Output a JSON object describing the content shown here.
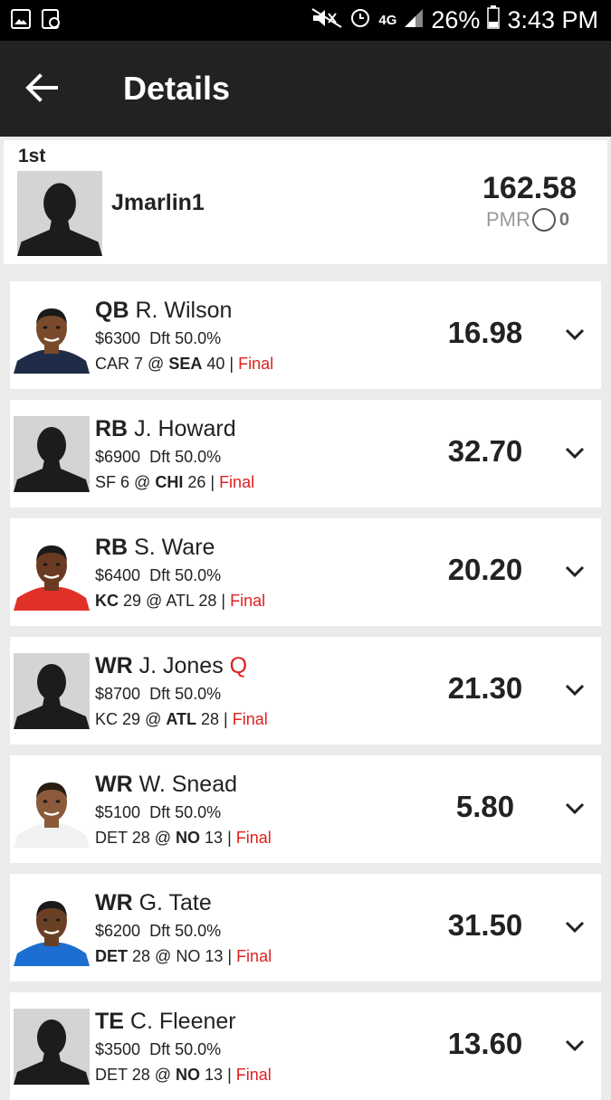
{
  "status_bar": {
    "battery": "26%",
    "time": "3:43 PM",
    "network": "4G",
    "icons": [
      "image-icon",
      "sync-icon",
      "mute-icon",
      "alarm-icon",
      "signal-icon",
      "battery-icon"
    ]
  },
  "app_bar": {
    "title": "Details",
    "back_icon": "arrow-left-icon"
  },
  "summary": {
    "rank": "1st",
    "username": "Jmarlin1",
    "total": "162.58",
    "pmr_label": "PMR",
    "pmr_value": "0"
  },
  "players": [
    {
      "pos": "QB",
      "name": "R. Wilson",
      "injury": "",
      "salary": "$6300",
      "drafted": "Dft 50.0%",
      "away": "CAR",
      "away_score": "7",
      "home": "SEA",
      "home_score": "40",
      "bold": "home",
      "status": "Final",
      "points": "16.98",
      "photo": "headshot",
      "skin": "#7a4a2c",
      "jersey": "#1e2c48",
      "hair": "#1a1a1a"
    },
    {
      "pos": "RB",
      "name": "J. Howard",
      "injury": "",
      "salary": "$6900",
      "drafted": "Dft 50.0%",
      "away": "SF",
      "away_score": "6",
      "home": "CHI",
      "home_score": "26",
      "bold": "home",
      "status": "Final",
      "points": "32.70",
      "photo": "silhouette"
    },
    {
      "pos": "RB",
      "name": "S. Ware",
      "injury": "",
      "salary": "$6400",
      "drafted": "Dft 50.0%",
      "away": "KC",
      "away_score": "29",
      "home": "ATL",
      "home_score": "28",
      "bold": "away",
      "status": "Final",
      "points": "20.20",
      "photo": "headshot",
      "skin": "#6a3a22",
      "jersey": "#e03028",
      "hair": "#1a1a1a"
    },
    {
      "pos": "WR",
      "name": "J. Jones",
      "injury": "Q",
      "salary": "$8700",
      "drafted": "Dft 50.0%",
      "away": "KC",
      "away_score": "29",
      "home": "ATL",
      "home_score": "28",
      "bold": "home",
      "status": "Final",
      "points": "21.30",
      "photo": "silhouette"
    },
    {
      "pos": "WR",
      "name": "W. Snead",
      "injury": "",
      "salary": "$5100",
      "drafted": "Dft 50.0%",
      "away": "DET",
      "away_score": "28",
      "home": "NO",
      "home_score": "13",
      "bold": "home",
      "status": "Final",
      "points": "5.80",
      "photo": "headshot",
      "skin": "#8a5a3a",
      "jersey": "#f2f2f2",
      "hair": "#2a1c10"
    },
    {
      "pos": "WR",
      "name": "G. Tate",
      "injury": "",
      "salary": "$6200",
      "drafted": "Dft 50.0%",
      "away": "DET",
      "away_score": "28",
      "home": "NO",
      "home_score": "13",
      "bold": "away",
      "status": "Final",
      "points": "31.50",
      "photo": "headshot",
      "skin": "#6a4024",
      "jersey": "#1c6fd0",
      "hair": "#1a1a1a"
    },
    {
      "pos": "TE",
      "name": "C. Fleener",
      "injury": "",
      "salary": "$3500",
      "drafted": "Dft 50.0%",
      "away": "DET",
      "away_score": "28",
      "home": "NO",
      "home_score": "13",
      "bold": "home",
      "status": "Final",
      "points": "13.60",
      "photo": "silhouette"
    }
  ]
}
